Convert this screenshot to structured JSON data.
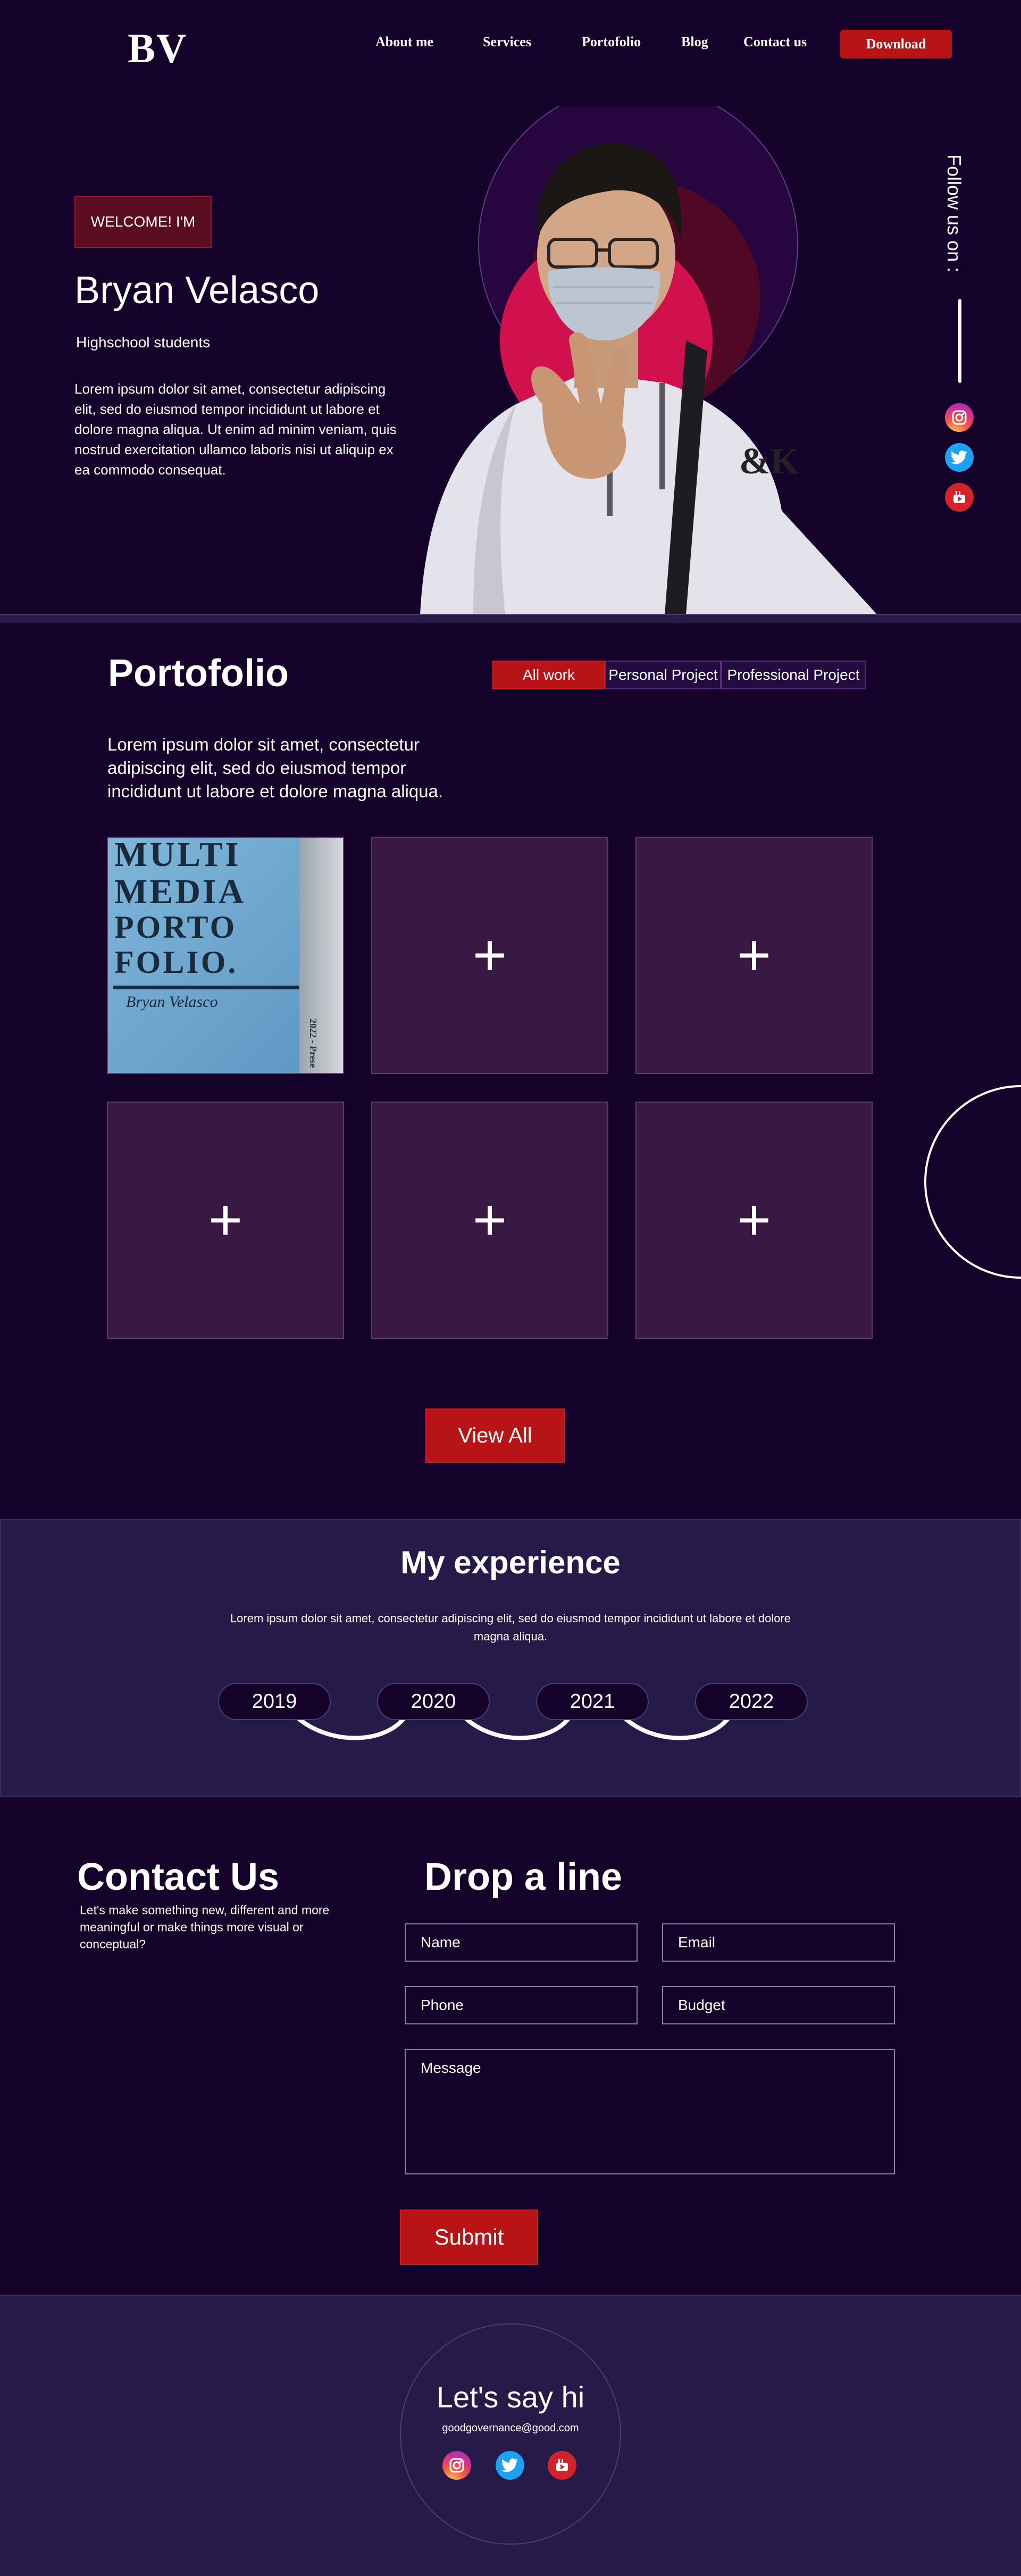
{
  "header": {
    "logo": "BV",
    "nav": [
      "About me",
      "Services",
      "Portofolio",
      "Blog",
      "Contact us"
    ],
    "download_label": "Download"
  },
  "hero": {
    "badge": "WELCOME! I'M",
    "name": "Bryan Velasco",
    "subtitle": "Highschool students",
    "description": "Lorem ipsum dolor sit amet, consectetur adipiscing elit, sed do eiusmod tempor incididunt ut labore et dolore magna aliqua. Ut enim ad minim veniam, quis nostrud exercitation ullamco laboris nisi ut aliquip ex ea commodo consequat.",
    "follow_label": "Follow us on :",
    "social_icons": [
      "instagram-icon",
      "twitter-icon",
      "youtube-icon"
    ]
  },
  "portfolio": {
    "title": "Portofolio",
    "filters": [
      "All work",
      "Personal Project",
      "Professional Project"
    ],
    "active_filter": "All work",
    "description": "Lorem ipsum dolor sit amet, consectetur adipiscing elit, sed do eiusmod tempor incididunt ut labore et dolore magna aliqua.",
    "cover": {
      "lines": [
        "MULTI",
        "MEDIA",
        "PORTO",
        "FOLIO."
      ],
      "signature": "Bryan Velasco",
      "spine": "2022 - Prese"
    },
    "add_symbol": "+",
    "view_all_label": "View All"
  },
  "experience": {
    "title": "My experience",
    "description": "Lorem ipsum dolor sit amet, consectetur adipiscing elit, sed do eiusmod tempor incididunt ut labore et dolore magna aliqua.",
    "years": [
      "2019",
      "2020",
      "2021",
      "2022"
    ]
  },
  "contact": {
    "title": "Contact Us",
    "description": "Let's make something new, different and more meaningful or make things more visual or conceptual?",
    "form_title": "Drop a line",
    "fields": {
      "name": "Name",
      "email": "Email",
      "phone": "Phone",
      "budget": "Budget",
      "message": "Message"
    },
    "submit_label": "Submit"
  },
  "footer": {
    "title": "Let's say hi",
    "email": "goodgovernance@good.com"
  },
  "colors": {
    "background": "#14022a",
    "accent_red": "#b81418",
    "panel": "#251a48",
    "tile": "#3a1844"
  }
}
